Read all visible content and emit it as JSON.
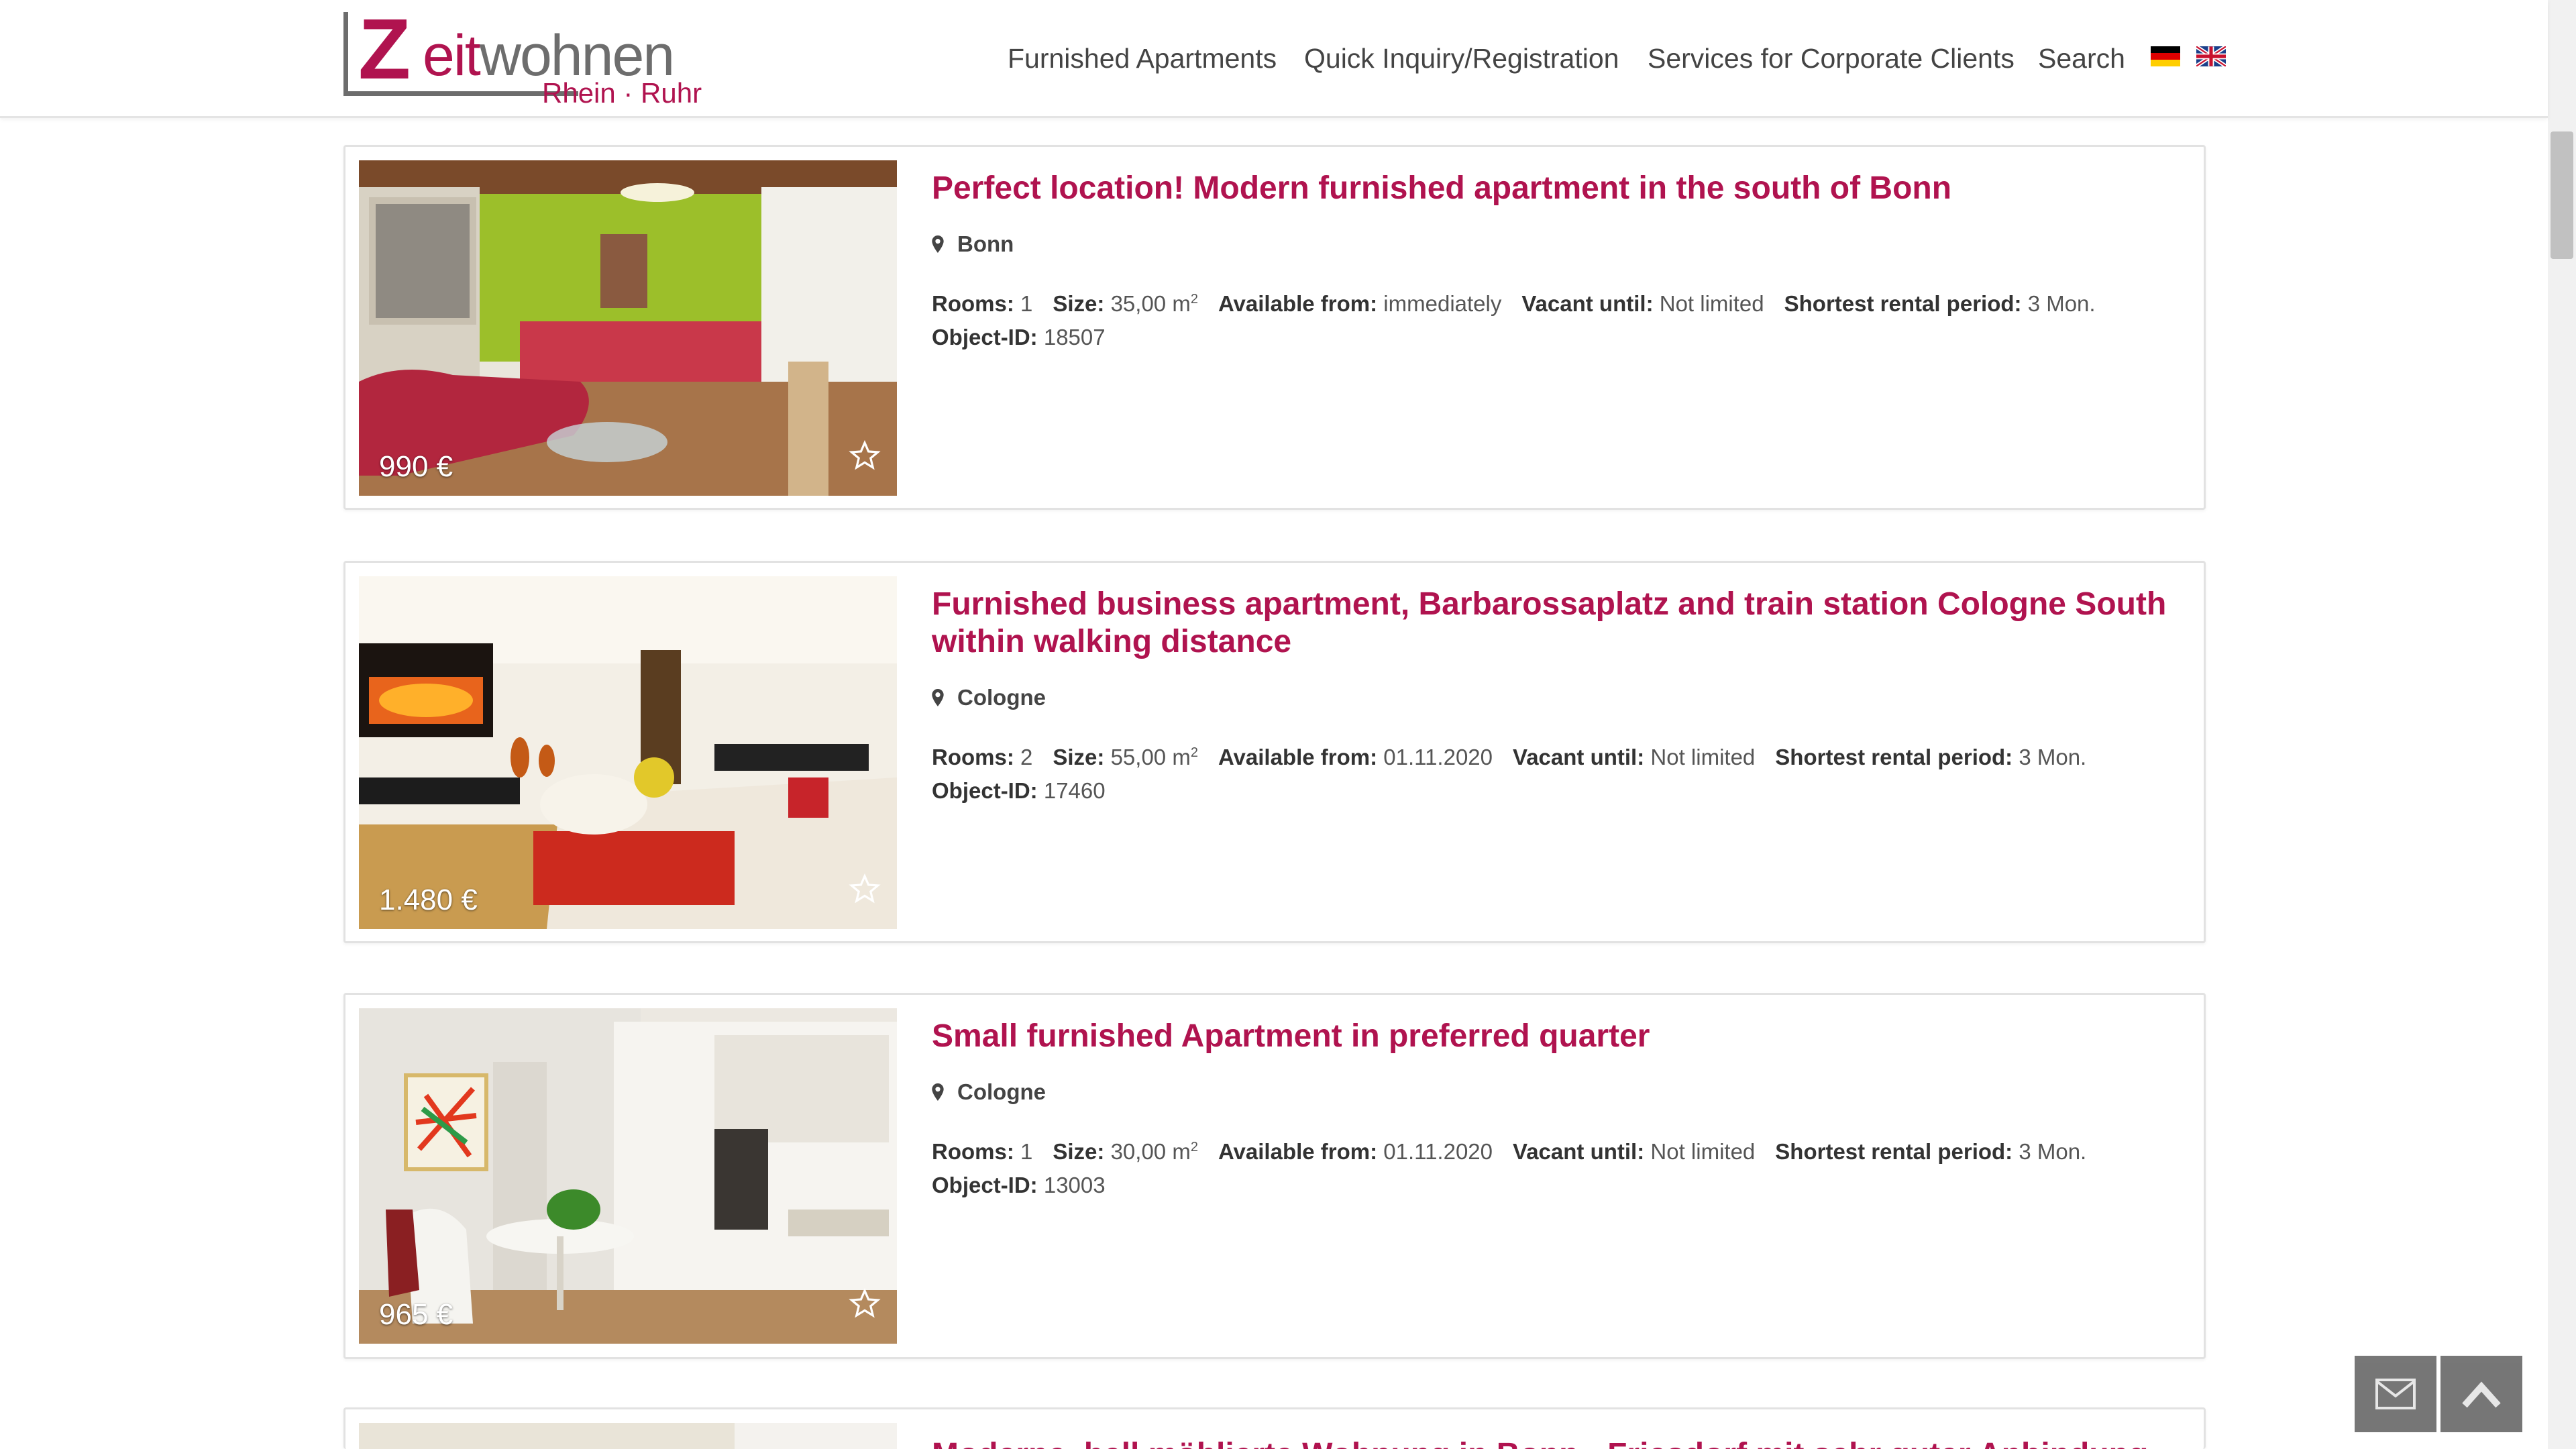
{
  "brand": {
    "logo_z": "Z",
    "logo_rest_1": "eit",
    "logo_rest_2": "wohnen",
    "logo_sub": "Rhein · Ruhr"
  },
  "nav": {
    "items": [
      "Furnished Apartments",
      "Quick Inquiry/Registration",
      "Services for Corporate Clients",
      "Search"
    ]
  },
  "labels": {
    "rooms": "Rooms:",
    "size": "Size:",
    "available_from": "Available from:",
    "vacant_until": "Vacant until:",
    "shortest_rental": "Shortest rental period:",
    "object_id": "Object-ID:"
  },
  "listings": [
    {
      "title": "Perfect location! Modern furnished apartment in the south of Bonn",
      "location": "Bonn",
      "price": "990 €",
      "rooms": "1",
      "size": "35,00 m",
      "size_sup": "2",
      "available_from": "immediately",
      "vacant_until": "Not limited",
      "shortest_rental": "3 Mon.",
      "object_id": "18507"
    },
    {
      "title": "Furnished business apartment, Barbarossaplatz and train station Cologne South within walking distance",
      "location": "Cologne",
      "price": "1.480 €",
      "rooms": "2",
      "size": "55,00 m",
      "size_sup": "2",
      "available_from": "01.11.2020",
      "vacant_until": "Not limited",
      "shortest_rental": "3 Mon.",
      "object_id": "17460"
    },
    {
      "title": "Small furnished Apartment in preferred quarter",
      "location": "Cologne",
      "price": "965 €",
      "rooms": "1",
      "size": "30,00 m",
      "size_sup": "2",
      "available_from": "01.11.2020",
      "vacant_until": "Not limited",
      "shortest_rental": "3 Mon.",
      "object_id": "13003"
    },
    {
      "title": "Moderne, hell möblierte Wohnung in Bonn - Friesdorf mit sehr guter Anbindung"
    }
  ],
  "icons": {
    "flag_de": "flag-de-icon",
    "flag_uk": "flag-uk-icon",
    "location": "map-marker-icon",
    "favorite": "star-outline-icon",
    "contact": "envelope-icon",
    "back_to_top": "chevron-up-icon"
  },
  "colors": {
    "accent": "#b0134f",
    "text": "#333333",
    "fab": "#6b6b6b"
  }
}
